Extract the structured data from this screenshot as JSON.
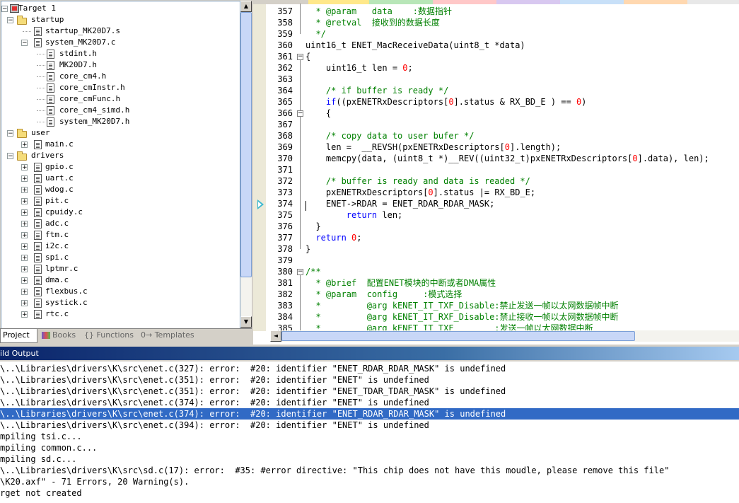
{
  "project": {
    "target": "Target 1",
    "groups": [
      {
        "name": "startup",
        "items": [
          {
            "name": "startup_MK20D7.s",
            "expanded": null
          },
          {
            "name": "system_MK20D7.c",
            "expanded": true,
            "children": [
              "stdint.h",
              "MK20D7.h",
              "core_cm4.h",
              "core_cmInstr.h",
              "core_cmFunc.h",
              "core_cm4_simd.h",
              "system_MK20D7.h"
            ]
          }
        ]
      },
      {
        "name": "user",
        "items": [
          {
            "name": "main.c"
          }
        ]
      },
      {
        "name": "drivers",
        "items": [
          {
            "name": "gpio.c"
          },
          {
            "name": "uart.c"
          },
          {
            "name": "wdog.c"
          },
          {
            "name": "pit.c"
          },
          {
            "name": "cpuidy.c"
          },
          {
            "name": "adc.c"
          },
          {
            "name": "ftm.c"
          },
          {
            "name": "i2c.c"
          },
          {
            "name": "spi.c"
          },
          {
            "name": "lptmr.c"
          },
          {
            "name": "dma.c"
          },
          {
            "name": "flexbus.c"
          },
          {
            "name": "systick.c"
          },
          {
            "name": "rtc.c"
          }
        ]
      }
    ],
    "tabs": [
      "Project",
      "Books",
      "{} Functions",
      "0→ Templates"
    ]
  },
  "editor": {
    "lines": [
      {
        "n": "357",
        "segs": [
          {
            "t": "  * @param   data    :数据指针",
            "c": "cm"
          }
        ]
      },
      {
        "n": "358",
        "segs": [
          {
            "t": "  * @retval  接收到的数据长度",
            "c": "cm"
          }
        ]
      },
      {
        "n": "359",
        "segs": [
          {
            "t": "  */",
            "c": "cm"
          }
        ]
      },
      {
        "n": "360",
        "segs": [
          {
            "t": "uint16_t ENET_MacReceiveData(uint8_t *data)",
            "c": ""
          }
        ]
      },
      {
        "n": "361",
        "segs": [
          {
            "t": "{",
            "c": ""
          }
        ]
      },
      {
        "n": "362",
        "segs": [
          {
            "t": "    uint16_t len = ",
            "c": ""
          },
          {
            "t": "0",
            "c": "nm"
          },
          {
            "t": ";",
            "c": ""
          }
        ]
      },
      {
        "n": "363",
        "segs": []
      },
      {
        "n": "364",
        "segs": [
          {
            "t": "    /* if buffer is ready */",
            "c": "cm"
          }
        ]
      },
      {
        "n": "365",
        "segs": [
          {
            "t": "    ",
            "c": ""
          },
          {
            "t": "if",
            "c": "kw"
          },
          {
            "t": "((pxENETRxDescriptors[",
            "c": ""
          },
          {
            "t": "0",
            "c": "nm"
          },
          {
            "t": "].status & RX_BD_E ) == ",
            "c": ""
          },
          {
            "t": "0",
            "c": "nm"
          },
          {
            "t": ")",
            "c": ""
          }
        ]
      },
      {
        "n": "366",
        "segs": [
          {
            "t": "    {",
            "c": ""
          }
        ]
      },
      {
        "n": "367",
        "segs": []
      },
      {
        "n": "368",
        "segs": [
          {
            "t": "    /* copy data to user bufer */",
            "c": "cm"
          }
        ]
      },
      {
        "n": "369",
        "segs": [
          {
            "t": "    len =  __REVSH(pxENETRxDescriptors[",
            "c": ""
          },
          {
            "t": "0",
            "c": "nm"
          },
          {
            "t": "].length);",
            "c": ""
          }
        ]
      },
      {
        "n": "370",
        "segs": [
          {
            "t": "    memcpy(data, (uint8_t *)__REV((uint32_t)pxENETRxDescriptors[",
            "c": ""
          },
          {
            "t": "0",
            "c": "nm"
          },
          {
            "t": "].data), len);",
            "c": ""
          }
        ]
      },
      {
        "n": "371",
        "segs": []
      },
      {
        "n": "372",
        "segs": [
          {
            "t": "    /* buffer is ready and data is readed */",
            "c": "cm"
          }
        ]
      },
      {
        "n": "373",
        "segs": [
          {
            "t": "    pxENETRxDescriptors[",
            "c": ""
          },
          {
            "t": "0",
            "c": "nm"
          },
          {
            "t": "].status |= RX_BD_E;",
            "c": ""
          }
        ]
      },
      {
        "n": "374",
        "segs": [
          {
            "t": "    ENET->RDAR = ENET_RDAR_RDAR_MASK;",
            "c": ""
          }
        ]
      },
      {
        "n": "375",
        "segs": [
          {
            "t": "        ",
            "c": ""
          },
          {
            "t": "return",
            "c": "kw"
          },
          {
            "t": " len;",
            "c": ""
          }
        ]
      },
      {
        "n": "376",
        "segs": [
          {
            "t": "  }",
            "c": ""
          }
        ]
      },
      {
        "n": "377",
        "segs": [
          {
            "t": "  ",
            "c": ""
          },
          {
            "t": "return",
            "c": "kw"
          },
          {
            "t": " ",
            "c": ""
          },
          {
            "t": "0",
            "c": "nm"
          },
          {
            "t": ";",
            "c": ""
          }
        ]
      },
      {
        "n": "378",
        "segs": [
          {
            "t": "}",
            "c": ""
          }
        ]
      },
      {
        "n": "379",
        "segs": []
      },
      {
        "n": "380",
        "segs": [
          {
            "t": "/**",
            "c": "cm"
          }
        ]
      },
      {
        "n": "381",
        "segs": [
          {
            "t": "  * @brief  配置ENET模块的中断或者DMA属性",
            "c": "cm"
          }
        ]
      },
      {
        "n": "382",
        "segs": [
          {
            "t": "  * @param  config     :模式选择",
            "c": "cm"
          }
        ]
      },
      {
        "n": "383",
        "segs": [
          {
            "t": "  *         @arg kENET_IT_TXF_Disable:禁止发送一帧以太网数据帧中断",
            "c": "cm"
          }
        ]
      },
      {
        "n": "384",
        "segs": [
          {
            "t": "  *         @arg kENET_IT_RXF_Disable:禁止接收一帧以太网数据帧中断",
            "c": "cm"
          }
        ]
      },
      {
        "n": "385",
        "segs": [
          {
            "t": "  *         @arg kENET_IT_TXF        :发送一帧以太网数据中断",
            "c": "cm"
          }
        ]
      }
    ],
    "current_line": "374"
  },
  "output": {
    "title": "ild Output",
    "lines": [
      "\\..\\Libraries\\drivers\\K\\src\\enet.c(327): error:  #20: identifier \"ENET_RDAR_RDAR_MASK\" is undefined",
      "\\..\\Libraries\\drivers\\K\\src\\enet.c(351): error:  #20: identifier \"ENET\" is undefined",
      "\\..\\Libraries\\drivers\\K\\src\\enet.c(351): error:  #20: identifier \"ENET_TDAR_TDAR_MASK\" is undefined",
      "\\..\\Libraries\\drivers\\K\\src\\enet.c(374): error:  #20: identifier \"ENET\" is undefined",
      "\\..\\Libraries\\drivers\\K\\src\\enet.c(374): error:  #20: identifier \"ENET_RDAR_RDAR_MASK\" is undefined",
      "\\..\\Libraries\\drivers\\K\\src\\enet.c(394): error:  #20: identifier \"ENET\" is undefined",
      "mpiling tsi.c...",
      "mpiling common.c...",
      "mpiling sd.c...",
      "\\..\\Libraries\\drivers\\K\\src\\sd.c(17): error:  #35: #error directive: \"This chip does not have this moudle, please remove this file\"",
      "\\K20.axf\" - 71 Errors, 20 Warning(s).",
      "rget not created"
    ],
    "selected_index": 4
  },
  "colors": {
    "selection": "#316ac5",
    "comment": "#008000",
    "keyword": "#0000ff",
    "number": "#ff0000",
    "title_gradient_start": "#0a246a"
  }
}
